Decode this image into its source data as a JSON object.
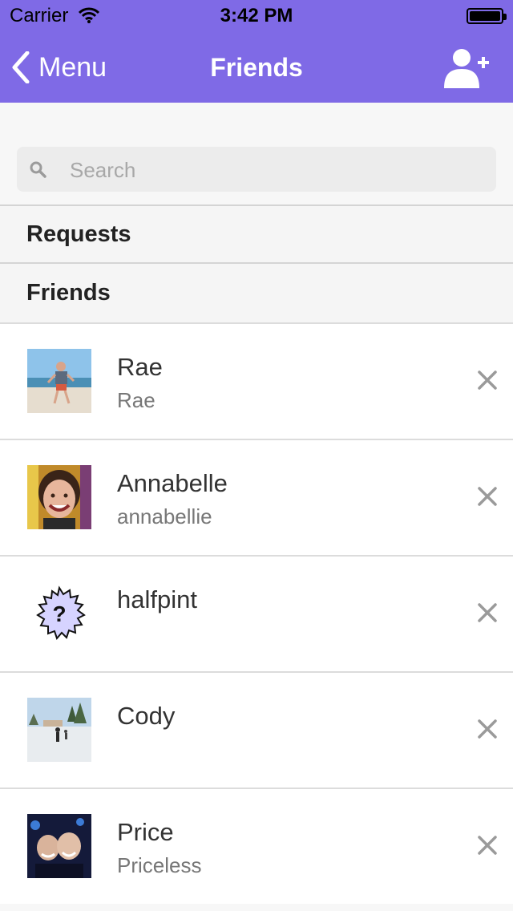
{
  "status_bar": {
    "carrier": "Carrier",
    "time": "3:42 PM"
  },
  "nav": {
    "back_label": "Menu",
    "title": "Friends",
    "add_icon": "add-friend-icon"
  },
  "search": {
    "placeholder": "Search",
    "value": ""
  },
  "sections": {
    "requests": "Requests",
    "friends": "Friends"
  },
  "friends": [
    {
      "name": "Rae",
      "username": "Rae"
    },
    {
      "name": "Annabelle",
      "username": "annabellie"
    },
    {
      "name": "halfpint",
      "username": ""
    },
    {
      "name": "Cody",
      "username": ""
    },
    {
      "name": "Price",
      "username": "Priceless"
    }
  ],
  "colors": {
    "accent": "#7f6ae6",
    "placeholder_avatar": "#d6d3ff"
  }
}
